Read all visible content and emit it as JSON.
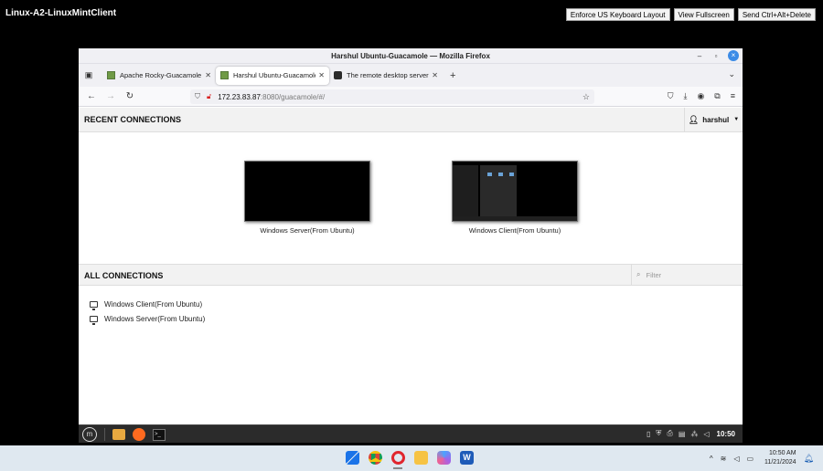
{
  "session": {
    "title": "Linux-A2-LinuxMintClient",
    "buttons": [
      "Enforce US Keyboard Layout",
      "View Fullscreen",
      "Send Ctrl+Alt+Delete"
    ]
  },
  "firefox": {
    "window_title": "Harshul Ubuntu-Guacamole — Mozilla Firefox",
    "tabs": [
      {
        "label": "Apache Rocky-Guacamole",
        "active": false,
        "icon": "guacamole-favicon"
      },
      {
        "label": "Harshul Ubuntu-Guacamole",
        "active": true,
        "icon": "guacamole-favicon"
      },
      {
        "label": "The remote desktop server",
        "active": false,
        "icon": "page-favicon"
      }
    ],
    "url": {
      "host": "172.23.83.87",
      "rest": ":8080/guacamole/#/"
    }
  },
  "guacamole": {
    "recent_title": "RECENT CONNECTIONS",
    "username": "harshul",
    "recent": [
      {
        "label": "Windows Server(From Ubuntu)"
      },
      {
        "label": "Windows Client(From Ubuntu)"
      }
    ],
    "all_title": "ALL CONNECTIONS",
    "filter_placeholder": "Filter",
    "connections": [
      {
        "label": "Windows Client(From Ubuntu)"
      },
      {
        "label": "Windows Server(From Ubuntu)"
      }
    ]
  },
  "mint_panel": {
    "clock": "10:50"
  },
  "windows_taskbar": {
    "time": "10:50 AM",
    "date": "11/21/2024"
  }
}
